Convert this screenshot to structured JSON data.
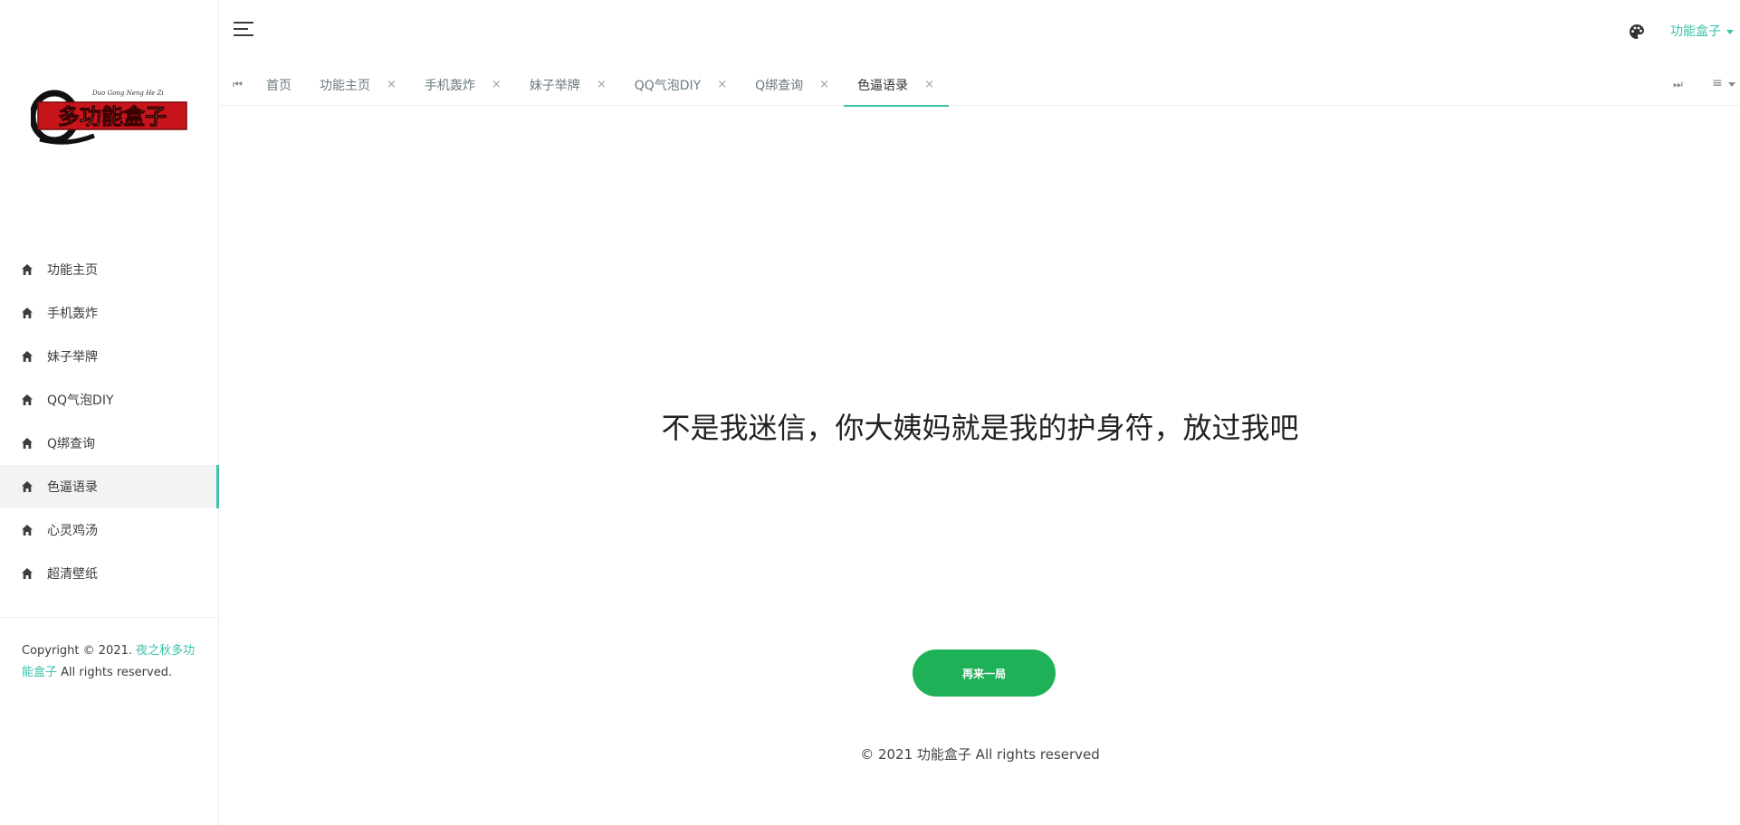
{
  "sidebar": {
    "logo_text": "多功能盒子",
    "logo_pinyin": "Duo Gong Neng He Zi",
    "items": [
      {
        "label": "功能主页",
        "icon": "home-icon",
        "active": false
      },
      {
        "label": "手机轰炸",
        "icon": "home-icon",
        "active": false
      },
      {
        "label": "妹子举牌",
        "icon": "home-icon",
        "active": false
      },
      {
        "label": "QQ气泡DIY",
        "icon": "home-icon",
        "active": false
      },
      {
        "label": "Q绑查询",
        "icon": "home-icon",
        "active": false
      },
      {
        "label": "色逼语录",
        "icon": "home-icon",
        "active": true
      },
      {
        "label": "心灵鸡汤",
        "icon": "home-icon",
        "active": false
      },
      {
        "label": "超清壁纸",
        "icon": "home-icon",
        "active": false
      }
    ],
    "copyright_prefix": "Copyright © 2021.",
    "copyright_link": "夜之秋多功能盒子",
    "copyright_suffix": "All rights reserved."
  },
  "header": {
    "menu_icon": "hamburger-icon",
    "theme_icon": "palette-icon",
    "user_label": "功能盒子"
  },
  "tabs": {
    "first_icon": "⏮",
    "last_icon": "⏭",
    "more_icon": "≡",
    "close_glyph": "×",
    "items": [
      {
        "label": "首页",
        "closable": false,
        "active": false
      },
      {
        "label": "功能主页",
        "closable": true,
        "active": false
      },
      {
        "label": "手机轰炸",
        "closable": true,
        "active": false
      },
      {
        "label": "妹子举牌",
        "closable": true,
        "active": false
      },
      {
        "label": "QQ气泡DIY",
        "closable": true,
        "active": false
      },
      {
        "label": "Q绑查询",
        "closable": true,
        "active": false
      },
      {
        "label": "色逼语录",
        "closable": true,
        "active": true
      }
    ]
  },
  "main": {
    "quote": "不是我迷信，你大姨妈就是我的护身符，放过我吧",
    "button_label": "再来一局",
    "footer": "© 2021 功能盒子 All rights reserved"
  },
  "colors": {
    "accent": "#3ec1aa",
    "button": "#1fb157",
    "logo_red": "#c8151b"
  }
}
